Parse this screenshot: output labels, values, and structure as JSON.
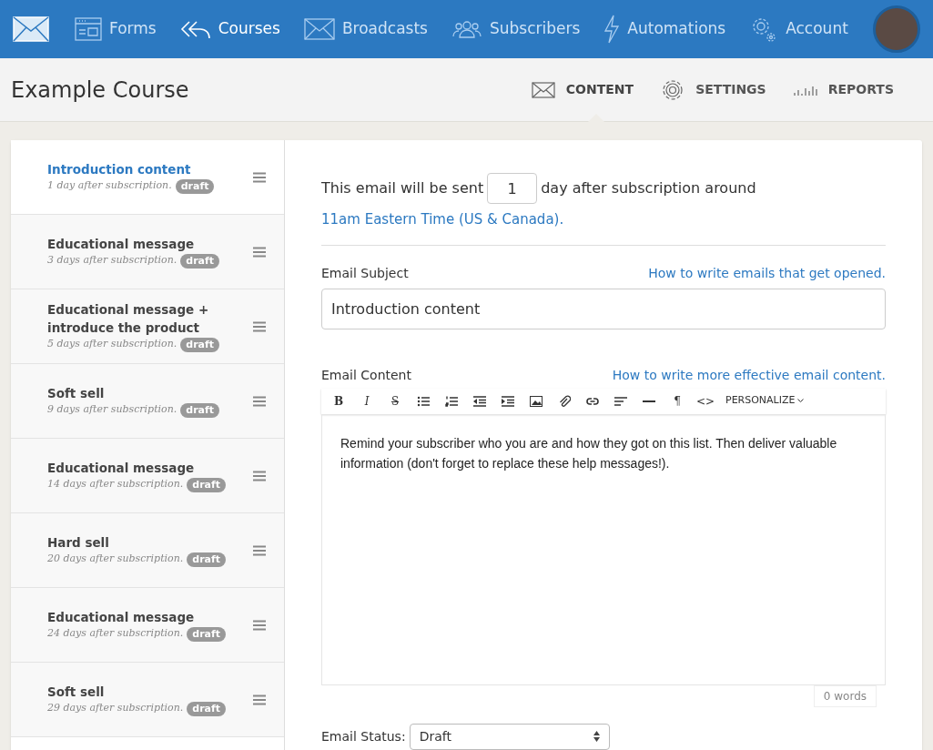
{
  "nav": {
    "items": [
      {
        "label": "Forms",
        "selected": false
      },
      {
        "label": "Courses",
        "selected": true
      },
      {
        "label": "Broadcasts",
        "selected": false
      },
      {
        "label": "Subscribers",
        "selected": false
      },
      {
        "label": "Automations",
        "selected": false
      },
      {
        "label": "Account",
        "selected": false
      }
    ]
  },
  "page_title": "Example Course",
  "tabs": [
    {
      "label": "CONTENT",
      "selected": true
    },
    {
      "label": "SETTINGS",
      "selected": false
    },
    {
      "label": "REPORTS",
      "selected": false
    }
  ],
  "emails": [
    {
      "title": "Introduction content",
      "timing": "1 day after subscription.",
      "badge": "draft",
      "selected": true
    },
    {
      "title": "Educational message",
      "timing": "3 days after subscription.",
      "badge": "draft",
      "selected": false
    },
    {
      "title": "Educational message + introduce the product",
      "timing": "5 days after subscription.",
      "badge": "draft",
      "selected": false
    },
    {
      "title": "Soft sell",
      "timing": "9 days after subscription.",
      "badge": "draft",
      "selected": false
    },
    {
      "title": "Educational message",
      "timing": "14 days after subscription.",
      "badge": "draft",
      "selected": false
    },
    {
      "title": "Hard sell",
      "timing": "20 days after subscription.",
      "badge": "draft",
      "selected": false
    },
    {
      "title": "Educational message",
      "timing": "24 days after subscription.",
      "badge": "draft",
      "selected": false
    },
    {
      "title": "Soft sell",
      "timing": "29 days after subscription.",
      "badge": "draft",
      "selected": false
    }
  ],
  "schedule": {
    "before": "This email will be sent",
    "days": "1",
    "after": "day after subscription around",
    "timezone_link": "11am Eastern Time (US & Canada)."
  },
  "subject": {
    "label": "Email Subject",
    "help_link": "How to write emails that get opened.",
    "value": "Introduction content"
  },
  "content": {
    "label": "Email Content",
    "help_link": "How to write more effective email content.",
    "toolbar": [
      {
        "kind": "text",
        "label": "B"
      },
      {
        "kind": "text",
        "label": "I"
      },
      {
        "kind": "text",
        "label": "S"
      },
      {
        "kind": "icon"
      },
      {
        "kind": "icon"
      },
      {
        "kind": "icon"
      },
      {
        "kind": "icon"
      },
      {
        "kind": "icon"
      },
      {
        "kind": "icon"
      },
      {
        "kind": "icon"
      },
      {
        "kind": "icon"
      },
      {
        "kind": "icon"
      },
      {
        "kind": "text",
        "label": "¶"
      },
      {
        "kind": "text",
        "label": "<>"
      },
      {
        "kind": "menu",
        "label": "PERSONALIZE"
      }
    ],
    "body": "Remind your subscriber who you are and how they got on this list. Then deliver valuable information (don't forget to replace these help messages!).",
    "word_count": "0 words"
  },
  "status": {
    "label": "Email Status:",
    "value": "Draft"
  }
}
